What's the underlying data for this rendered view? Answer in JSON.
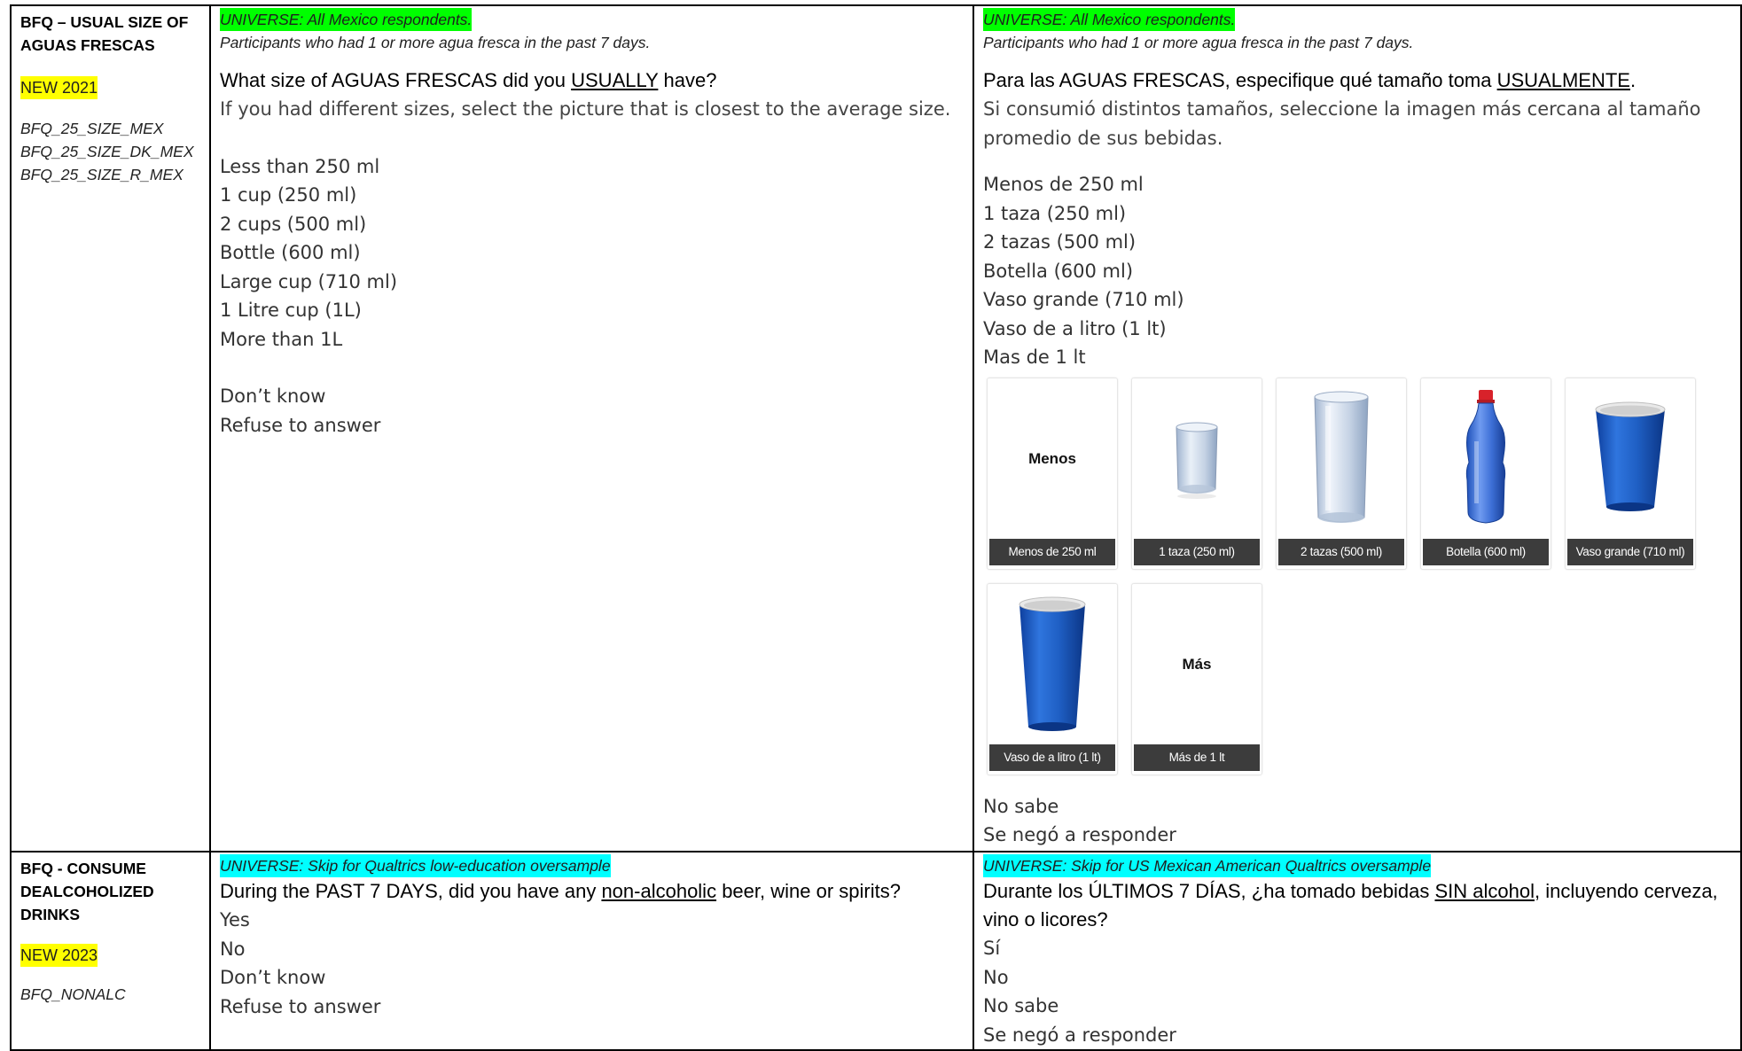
{
  "row1": {
    "section_title": "BFQ – USUAL SIZE OF AGUAS FRESCAS",
    "new_badge": "NEW 2021",
    "variables": [
      "BFQ_25_SIZE_MEX",
      "BFQ_25_SIZE_DK_MEX",
      "BFQ_25_SIZE_R_MEX"
    ],
    "en": {
      "universe": "UNIVERSE: All Mexico respondents.",
      "participants": "Participants who had 1 or more agua fresca in the past 7 days.",
      "question_before": "What size of AGUAS FRESCAS did you ",
      "question_underlined": "USUALLY",
      "question_after": " have?",
      "instruction": "If you had different sizes, select the picture that is closest to the average size.",
      "options": [
        "Less than 250 ml",
        "1 cup (250 ml)",
        "2 cups (500 ml)",
        "Bottle (600 ml)",
        "Large cup (710 ml)",
        "1 Litre cup (1L)",
        "More than 1L"
      ],
      "extra_options": [
        "Don’t know",
        "Refuse to answer"
      ]
    },
    "es": {
      "universe": "UNIVERSE: All Mexico respondents.",
      "participants": "Participants who had 1 or more agua fresca in the past 7 days.",
      "question_before": "Para las AGUAS FRESCAS, especifique qué tamaño toma ",
      "question_underlined": "USUALMENTE",
      "question_after": ".",
      "instruction": "Si consumió distintos tamaños, seleccione la imagen más cercana al tamaño promedio de sus bebidas.",
      "options": [
        "Menos de 250 ml",
        "1 taza (250 ml)",
        "2 tazas (500 ml)",
        "Botella (600 ml)",
        "Vaso grande (710 ml)",
        "Vaso de a litro (1 lt)",
        "Mas de 1 lt"
      ],
      "cards": [
        {
          "caption": "Menos de 250 ml",
          "word": "Menos",
          "icon": "text-only"
        },
        {
          "caption": "1 taza (250 ml)",
          "icon": "small-clear-glass-icon"
        },
        {
          "caption": "2 tazas (500 ml)",
          "icon": "tall-clear-glass-icon"
        },
        {
          "caption": "Botella (600 ml)",
          "icon": "plastic-bottle-icon"
        },
        {
          "caption": "Vaso grande (710 ml)",
          "icon": "blue-cup-icon"
        },
        {
          "caption": "Vaso de a litro (1 lt)",
          "icon": "tall-blue-cup-icon"
        },
        {
          "caption": "Más de 1 lt",
          "word": "Más",
          "icon": "text-only"
        }
      ],
      "extra_options": [
        "No sabe",
        "Se negó a responder"
      ]
    }
  },
  "row2": {
    "section_title": "BFQ - CONSUME DEALCOHOLIZED DRINKS",
    "new_badge": "NEW 2023",
    "variables": [
      "BFQ_NONALC"
    ],
    "en": {
      "universe": "UNIVERSE: Skip for Qualtrics low-education oversample",
      "question_before": "During the PAST 7 DAYS, did you have any ",
      "question_underlined": "non-alcoholic",
      "question_after": " beer, wine or spirits?",
      "options": [
        "Yes",
        "No",
        "Don’t know",
        "Refuse to answer"
      ]
    },
    "es": {
      "universe": "UNIVERSE: Skip for US Mexican American Qualtrics oversample",
      "question_before": "Durante los ÚLTIMOS 7 DÍAS, ¿ha tomado bebidas ",
      "question_underlined": "SIN alcohol",
      "question_after": ", incluyendo cerveza, vino o licores?",
      "options": [
        "Sí",
        "No",
        "No sabe",
        "Se negó a responder"
      ]
    }
  },
  "colors": {
    "highlight_yellow": "#ffff00",
    "highlight_green": "#00ff00",
    "highlight_cyan": "#00ffff",
    "cup_blue": "#1f5fc4"
  }
}
